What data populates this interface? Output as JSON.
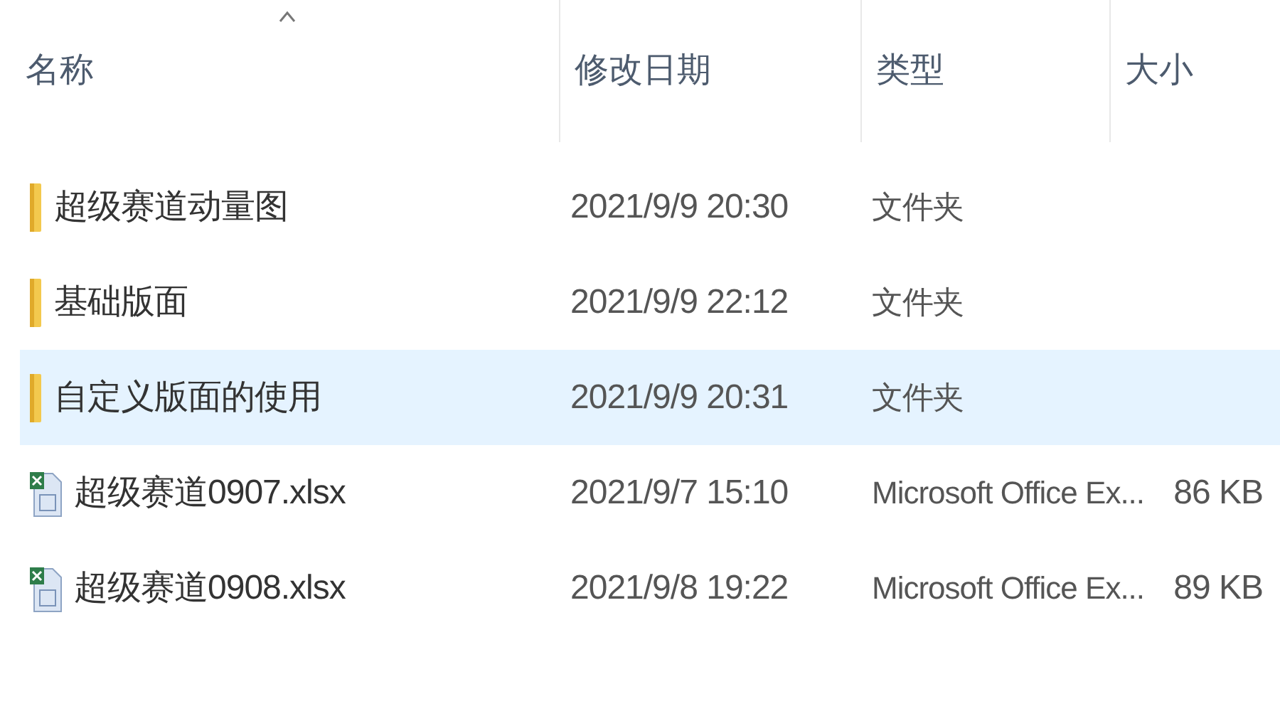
{
  "columns": [
    {
      "label": "名称",
      "sorted": true
    },
    {
      "label": "修改日期"
    },
    {
      "label": "类型"
    },
    {
      "label": "大小"
    }
  ],
  "files": [
    {
      "kind": "folder",
      "name": "超级赛道动量图",
      "modified": "2021/9/9 20:30",
      "type": "文件夹",
      "selected": false
    },
    {
      "kind": "folder",
      "name": "基础版面",
      "modified": "2021/9/9 22:12",
      "type": "文件夹",
      "selected": false
    },
    {
      "kind": "folder",
      "name": "自定义版面的使用",
      "modified": "2021/9/9 20:31",
      "type": "文件夹",
      "selected": true
    },
    {
      "kind": "excel",
      "name": "超级赛道0907.xlsx",
      "modified": "2021/9/7 15:10",
      "type": "Microsoft Office Ex...",
      "size": "86 KB",
      "selected": false
    },
    {
      "kind": "excel",
      "name": "超级赛道0908.xlsx",
      "modified": "2021/9/8 19:22",
      "type": "Microsoft Office Ex...",
      "size": "89 KB",
      "selected": false
    }
  ]
}
